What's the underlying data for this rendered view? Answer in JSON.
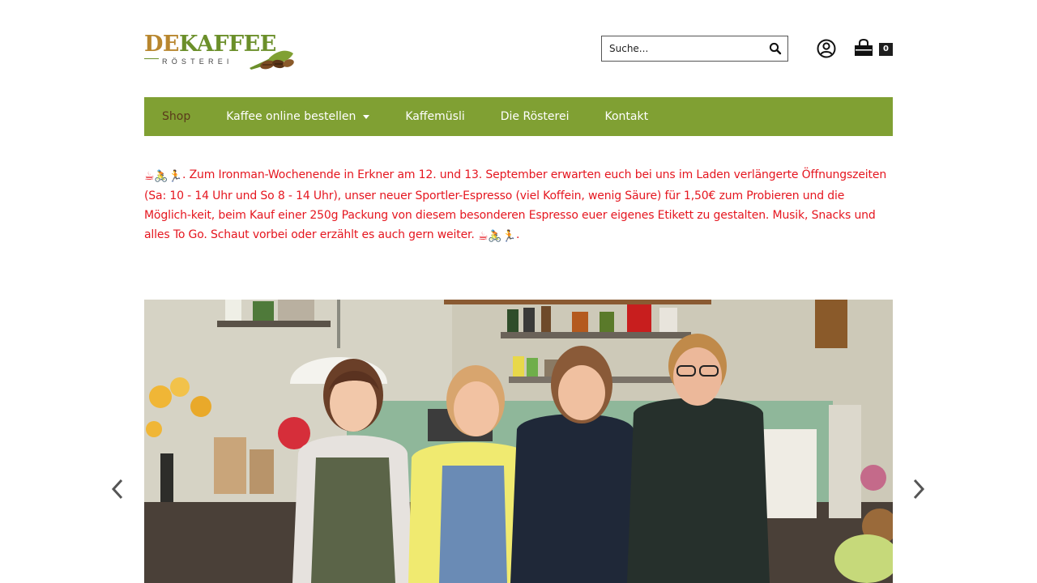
{
  "brand": {
    "logo_word_de": "DE",
    "logo_word_kaffee": "KAFFEE",
    "logo_sub": "RÖSTEREI"
  },
  "search": {
    "placeholder": "Suche..."
  },
  "cart": {
    "count": "0"
  },
  "nav": {
    "items": [
      {
        "label": "Shop",
        "active": true
      },
      {
        "label": "Kaffee online bestellen",
        "has_dropdown": true
      },
      {
        "label": "Kaffemüsli"
      },
      {
        "label": "Die Rösterei"
      },
      {
        "label": "Kontakt"
      }
    ]
  },
  "announcement": {
    "emoji_lead": "☕🚴🏃",
    "text": ". Zum Ironman-Wochenende in Erkner am 12. und 13. September erwarten euch bei uns im Laden verlängerte Öffnungszeiten (Sa: 10 - 14 Uhr und So 8 - 14 Uhr), unser neuer Sportler-Espresso (viel Koffein, wenig Säure) für 1,50€ zum Probieren und die Möglich-keit, beim Kauf einer 250g Packung von diesem besonderen Espresso euer eigenes Etikett zu gestalten. Musik, Snacks und alles To Go. Schaut vorbei oder erzählt es auch gern weiter.",
    "emoji_trail": "☕🚴🏃",
    "trail_dot": "."
  },
  "colors": {
    "nav_bg": "#80a033",
    "nav_active": "#5a3a1a",
    "announcement": "#e5161f",
    "badge_bg": "#1e1e1e"
  },
  "icons": {
    "search": "search-icon",
    "user": "user-icon",
    "cart": "shopping-bag-icon",
    "prev": "chevron-left-icon",
    "next": "chevron-right-icon",
    "dropdown": "caret-down-icon"
  }
}
